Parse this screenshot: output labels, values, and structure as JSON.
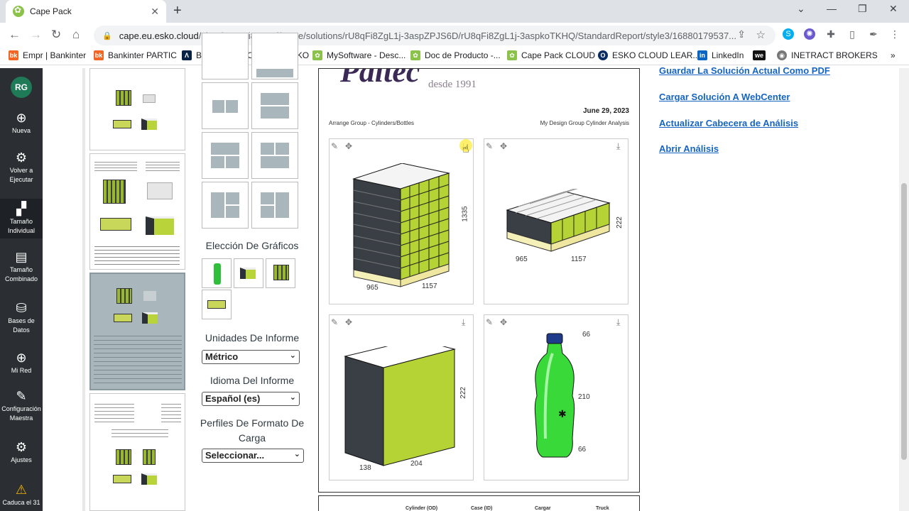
{
  "browser": {
    "tab_title": "Cape Pack",
    "url_host": "cape.eu.esko.cloud",
    "url_path": "/sites/rU8qFi8ZgL1j/Cape/solutions/rU8qFi8ZgL1j-3aspZPJS6D/rU8qFi8ZgL1j-3aspkoTKHQ/StandardReport/style3/16880179537..."
  },
  "bookmarks": [
    {
      "label": "Empr | Bankinter",
      "color": "#f26522",
      "glyph": "bk"
    },
    {
      "label": "Bankinter PARTIC",
      "color": "#f26522",
      "glyph": "bk"
    },
    {
      "label": "BBVA",
      "color": "#072146",
      "glyph": "Λ"
    },
    {
      "label": "SOPORTE ESKO",
      "color": "#0091da",
      "glyph": "☁"
    },
    {
      "label": "MySoftware - Desc...",
      "color": "#8bc34a",
      "glyph": "✿"
    },
    {
      "label": "Doc de Producto -...",
      "color": "#8bc34a",
      "glyph": "✿"
    },
    {
      "label": "Cape Pack CLOUD",
      "color": "#8bc34a",
      "glyph": "✿"
    },
    {
      "label": "ESKO CLOUD LEAR...",
      "color": "#0b2c63",
      "glyph": "O"
    },
    {
      "label": "LinkedIn",
      "color": "#0a66c2",
      "glyph": "in"
    },
    {
      "label": "",
      "color": "#111111",
      "glyph": "we"
    },
    {
      "label": "INETRACT BROKERS",
      "color": "#777777",
      "glyph": "◉"
    }
  ],
  "sidebar": {
    "avatar": "RG",
    "items": [
      {
        "label": "Nueva",
        "icon": "⊕"
      },
      {
        "label": "Volver a Ejecutar",
        "icon": "⚙"
      },
      {
        "label": "Tamaño Individual",
        "icon": "▞"
      },
      {
        "label": "Tamaño Combinado",
        "icon": "▤"
      },
      {
        "label": "Bases de Datos",
        "icon": "⛁"
      },
      {
        "label": "Mi Red",
        "icon": "⊕"
      },
      {
        "label": "Configuración Maestra",
        "icon": "✎"
      },
      {
        "label": "Ajustes",
        "icon": "⚙"
      },
      {
        "label": "Caduca el 31",
        "icon": "⚠"
      }
    ]
  },
  "options": {
    "graphics_title": "Elección De Gráficos",
    "units_title": "Unidades De Informe",
    "units_value": "Métrico",
    "language_title": "Idioma Del Informe",
    "language_value": "Español (es)",
    "profiles_title": "Perfiles De Formato De Carga",
    "profiles_value": "Seleccionar..."
  },
  "report": {
    "brand": "Paltec",
    "brand_sub": "desde 1991",
    "date": "June 29, 2023",
    "left_sub": "Arrange Group - Cylinders/Bottles",
    "right_sub": "My Design Group Cylinder Analysis",
    "panels": {
      "pallet": {
        "w": "965",
        "d": "1157",
        "h": "1335"
      },
      "layer": {
        "w": "965",
        "d": "1157",
        "h": "222"
      },
      "case": {
        "w": "138",
        "d": "204",
        "h": "222"
      },
      "bottle": {
        "top": "66",
        "h": "210",
        "bottom": "66"
      }
    },
    "table_headers": [
      "Cylinder (OD)",
      "Case (ID)",
      "Cargar",
      "Truck"
    ]
  },
  "links": [
    "Guardar La Solución Actual Como PDF",
    "Cargar Solución A WebCenter",
    "Actualizar Cabecera de Análisis",
    "Abrir Análisis"
  ],
  "colors": {
    "accent_green": "#b5d334",
    "dark_sidebar": "#2b2f33",
    "link": "#1565c0"
  }
}
